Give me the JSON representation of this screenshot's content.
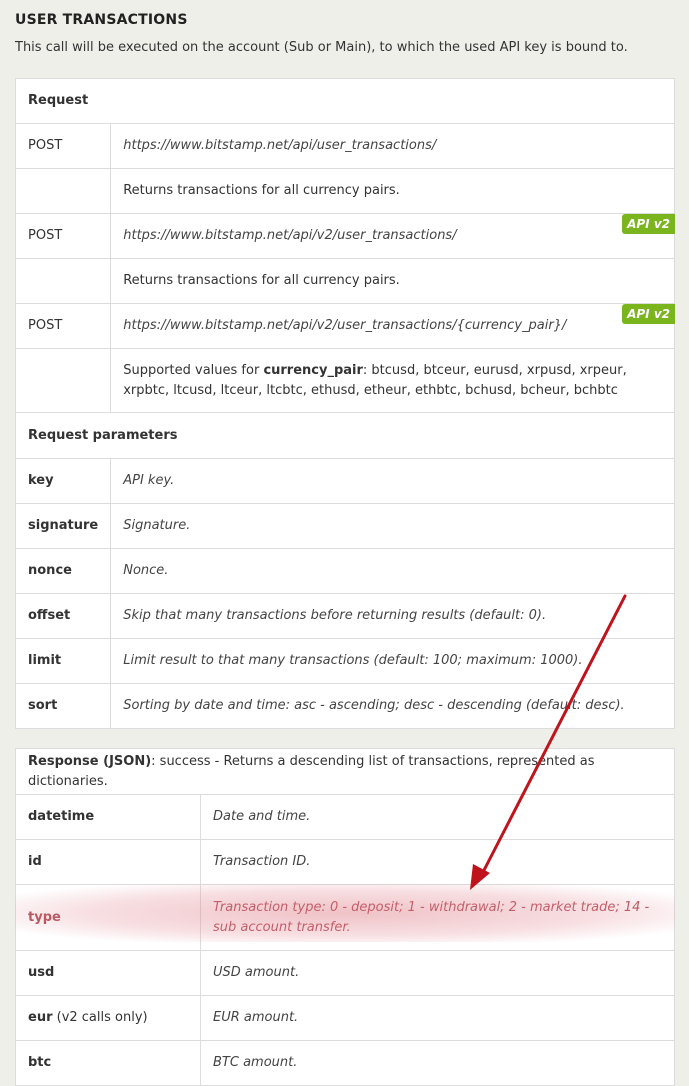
{
  "title": "USER TRANSACTIONS",
  "intro": "This call will be executed on the account (Sub or Main), to which the used API key is bound to.",
  "request": {
    "header": "Request",
    "rows": [
      {
        "method": "POST",
        "url": "https://www.bitstamp.net/api/user_transactions/",
        "badge": ""
      },
      {
        "method": "",
        "text": "Returns transactions for all currency pairs."
      },
      {
        "method": "POST",
        "url": "https://www.bitstamp.net/api/v2/user_transactions/",
        "badge": "API v2"
      },
      {
        "method": "",
        "text": "Returns transactions for all currency pairs."
      },
      {
        "method": "POST",
        "url": "https://www.bitstamp.net/api/v2/user_transactions/{currency_pair}/",
        "badge": "API v2"
      }
    ],
    "supported_prefix": "Supported values for ",
    "supported_key": "currency_pair",
    "supported_values": ": btcusd, btceur, eurusd, xrpusd, xrpeur, xrpbtc, ltcusd, ltceur, ltcbtc, ethusd, etheur, ethbtc, bchusd, bcheur, bchbtc"
  },
  "params": {
    "header": "Request parameters",
    "rows": [
      {
        "name": "key",
        "desc": "API key."
      },
      {
        "name": "signature",
        "desc": "Signature."
      },
      {
        "name": "nonce",
        "desc": "Nonce."
      },
      {
        "name": "offset",
        "desc": "Skip that many transactions before returning results (default: 0)."
      },
      {
        "name": "limit",
        "desc": "Limit result to that many transactions (default: 100; maximum: 1000)."
      },
      {
        "name": "sort",
        "desc": "Sorting by date and time: asc - ascending; desc - descending (default: desc)."
      }
    ]
  },
  "response": {
    "header_bold": "Response (JSON)",
    "header_rest": ": success - Returns a descending list of transactions, represented as dictionaries.",
    "rows": [
      {
        "name": "datetime",
        "note": "",
        "desc": "Date and time."
      },
      {
        "name": "id",
        "note": "",
        "desc": "Transaction ID."
      },
      {
        "name": "type",
        "note": "",
        "desc": "Transaction type: 0 - deposit; 1 - withdrawal; 2 - market trade; 14 - sub account transfer."
      },
      {
        "name": "usd",
        "note": "",
        "desc": "USD amount."
      },
      {
        "name": "eur",
        "note": " (v2 calls only)",
        "desc": "EUR amount."
      },
      {
        "name": "btc",
        "note": "",
        "desc": "BTC amount."
      }
    ]
  },
  "colors": {
    "badge": "#7ab51d",
    "arrow": "#c0141c",
    "highlight": "#e08a95"
  }
}
